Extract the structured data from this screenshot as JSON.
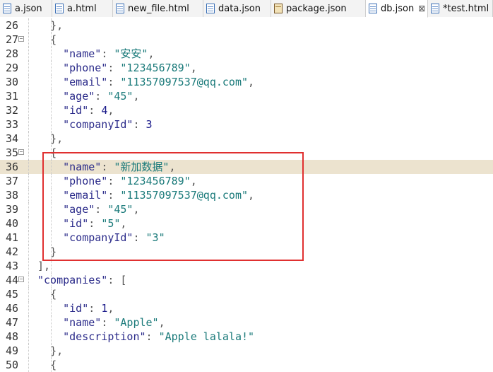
{
  "tabs": [
    {
      "label": "a.json",
      "active": false,
      "closable": false
    },
    {
      "label": "a.html",
      "active": false,
      "closable": false
    },
    {
      "label": "new_file.html",
      "active": false,
      "closable": false
    },
    {
      "label": "data.json",
      "active": false,
      "closable": false
    },
    {
      "label": "package.json",
      "active": false,
      "closable": false
    },
    {
      "label": "db.json",
      "active": true,
      "closable": true,
      "close_glyph": "⊠"
    },
    {
      "label": "*test.html",
      "active": false,
      "closable": false
    }
  ],
  "editor": {
    "current_line": 36,
    "lines": [
      {
        "num": "26",
        "text": "  },"
      },
      {
        "num": "27",
        "text": "  {",
        "fold": "−"
      },
      {
        "num": "28",
        "text": "    \"name\": \"安安\","
      },
      {
        "num": "29",
        "text": "    \"phone\": \"123456789\","
      },
      {
        "num": "30",
        "text": "    \"email\": \"11357097537@qq.com\","
      },
      {
        "num": "31",
        "text": "    \"age\": \"45\","
      },
      {
        "num": "32",
        "text": "    \"id\": 4,"
      },
      {
        "num": "33",
        "text": "    \"companyId\": 3"
      },
      {
        "num": "34",
        "text": "  },"
      },
      {
        "num": "35",
        "text": "  {",
        "fold": "−"
      },
      {
        "num": "36",
        "text": "    \"name\": \"新加数据\","
      },
      {
        "num": "37",
        "text": "    \"phone\": \"123456789\","
      },
      {
        "num": "38",
        "text": "    \"email\": \"11357097537@qq.com\","
      },
      {
        "num": "39",
        "text": "    \"age\": \"45\","
      },
      {
        "num": "40",
        "text": "    \"id\": \"5\","
      },
      {
        "num": "41",
        "text": "    \"companyId\": \"3\""
      },
      {
        "num": "42",
        "text": "  }"
      },
      {
        "num": "43",
        "text": "],"
      },
      {
        "num": "44",
        "text": "\"companies\": [",
        "fold": "−"
      },
      {
        "num": "45",
        "text": "  {"
      },
      {
        "num": "46",
        "text": "    \"id\": 1,"
      },
      {
        "num": "47",
        "text": "    \"name\": \"Apple\","
      },
      {
        "num": "48",
        "text": "    \"description\": \"Apple lalala!\""
      },
      {
        "num": "49",
        "text": "  },"
      },
      {
        "num": "50",
        "text": "  {"
      }
    ]
  },
  "annotation": {
    "color": "#e03030",
    "from_line": 35,
    "to_line": 42
  }
}
